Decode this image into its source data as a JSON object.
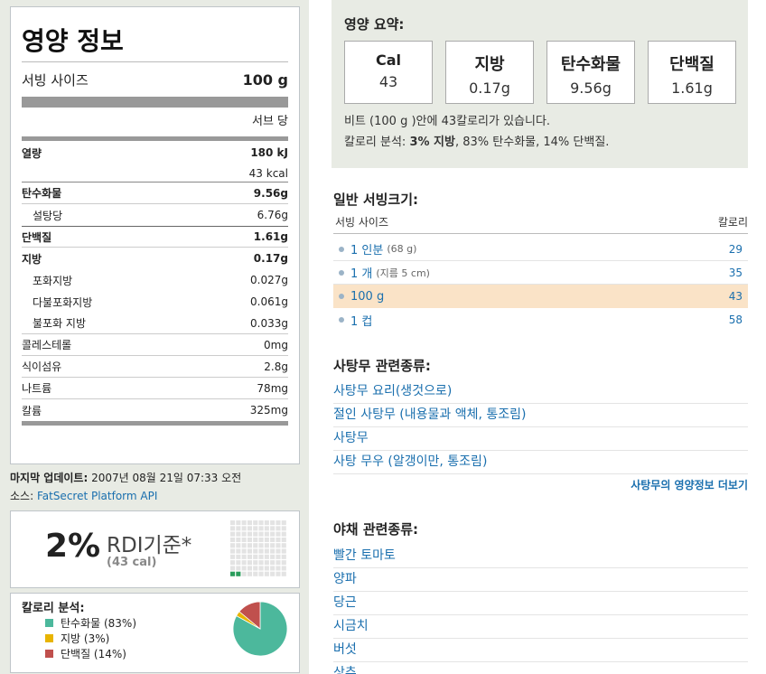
{
  "nutrition": {
    "title": "영양 정보",
    "serving_label": "서빙 사이즈",
    "serving_value": "100 g",
    "per_label": "서브 당",
    "energy_label": "열량",
    "energy_kj": "180 kJ",
    "energy_kcal": "43 kcal",
    "rows": [
      {
        "label": "탄수화물",
        "value": "9.56g"
      },
      {
        "label": "설탕당",
        "value": "6.76g"
      },
      {
        "label": "단백질",
        "value": "1.61g"
      },
      {
        "label": "지방",
        "value": "0.17g"
      },
      {
        "label": "포화지방",
        "value": "0.027g"
      },
      {
        "label": "다불포화지방",
        "value": "0.061g"
      },
      {
        "label": "불포화 지방",
        "value": "0.033g"
      },
      {
        "label": "콜레스테롤",
        "value": "0mg"
      },
      {
        "label": "식이섬유",
        "value": "2.8g"
      },
      {
        "label": "나트륨",
        "value": "78mg"
      },
      {
        "label": "칼륨",
        "value": "325mg"
      }
    ]
  },
  "update": {
    "label": "마지막 업데이트:",
    "value": "2007년 08월 21일 07:33 오전",
    "source_label": "소스:",
    "source_link": "FatSecret Platform API"
  },
  "rdi": {
    "percent": "2%",
    "label": "RDI기준*",
    "cal": "(43 cal)",
    "filled_fraction": 0.02
  },
  "calorie_breakdown": {
    "title": "칼로리 분석:",
    "items": [
      {
        "label": "탄수화물 (83%)",
        "percent": 83,
        "color": "#4cb89c"
      },
      {
        "label": "지방 (3%)",
        "percent": 3,
        "color": "#e8b400"
      },
      {
        "label": "단백질 (14%)",
        "percent": 14,
        "color": "#c0504d"
      }
    ]
  },
  "summary": {
    "title": "영양 요약:",
    "boxes": [
      {
        "label": "Cal",
        "value": "43"
      },
      {
        "label": "지방",
        "value": "0.17g"
      },
      {
        "label": "탄수화물",
        "value": "9.56g"
      },
      {
        "label": "단백질",
        "value": "1.61g"
      }
    ],
    "line1": "비트 (100 g )안에 43칼로리가 있습니다.",
    "line2_prefix": "칼로리 분석: ",
    "line2_bold": "3% 지방",
    "line2_rest": ", 83% 탄수화물, 14% 단백질."
  },
  "servings": {
    "title": "일반 서빙크기:",
    "col_size": "서빙 사이즈",
    "col_cal": "칼로리",
    "rows": [
      {
        "label": "1 인분",
        "sub": "(68 g)",
        "cal": "29"
      },
      {
        "label": "1 개",
        "sub": "(지름 5 cm)",
        "cal": "35"
      },
      {
        "label": "100 g",
        "sub": "",
        "cal": "43"
      },
      {
        "label": "1 컵",
        "sub": "",
        "cal": "58"
      }
    ]
  },
  "related_beet": {
    "title": "사탕무 관련종류:",
    "items": [
      "사탕무 요리(생것으로)",
      "절인 사탕무 (내용물과 액체, 통조림)",
      "사탕무",
      "사탕 무우 (알갱이만, 통조림)"
    ],
    "more": "사탕무의 영양정보 더보기"
  },
  "related_veg": {
    "title": "야채 관련종류:",
    "items": [
      "빨간 토마토",
      "양파",
      "당근",
      "시금치",
      "버섯",
      "상추"
    ]
  }
}
